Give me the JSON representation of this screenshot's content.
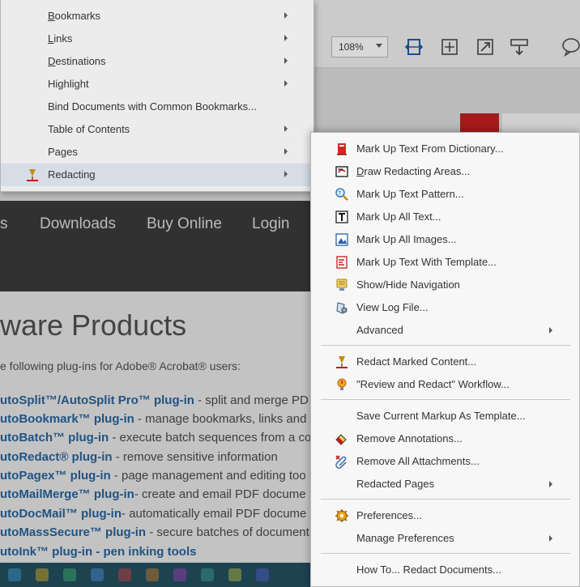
{
  "toolbar": {
    "zoom": "108%"
  },
  "website": {
    "nav": [
      "s",
      "Downloads",
      "Buy Online",
      "Login"
    ],
    "title": "ware Products",
    "intro": "e following plug-ins for Adobe® Acrobat® users:",
    "products": [
      {
        "link": "utoSplit™/AutoSplit Pro™ plug-in",
        "desc": " - split and merge PD"
      },
      {
        "link": "utoBookmark™ plug-in",
        "desc": " - manage bookmarks, links and"
      },
      {
        "link": "utoBatch™ plug-in",
        "desc": " - execute batch sequences from a co"
      },
      {
        "link": "utoRedact® plug-in",
        "desc": " - remove sensitive information"
      },
      {
        "link": "utoPagex™ plug-in",
        "desc": " - page management and editing too"
      },
      {
        "link": "utoMailMerge™ plug-in",
        "desc": "- create and email PDF docume"
      },
      {
        "link": "utoDocMail™ plug-in",
        "desc": "- automatically email PDF docume"
      },
      {
        "link": "utoMassSecure™ plug-in",
        "desc": " - secure batches of document"
      },
      {
        "link": "utoInk™ plug-in - pen inking tools",
        "desc": ""
      }
    ]
  },
  "left_menu": {
    "items": [
      {
        "label": "Bookmarks",
        "mnemonic": "B",
        "rest": "ookmarks",
        "submenu": true
      },
      {
        "label": "Links",
        "mnemonic": "L",
        "rest": "inks",
        "submenu": true
      },
      {
        "label": "Destinations",
        "mnemonic": "D",
        "rest": "estinations",
        "submenu": true
      },
      {
        "label": "Highlight",
        "mnemonic": "",
        "rest": "Highlight",
        "submenu": true
      },
      {
        "label": "Bind Documents with Common Bookmarks...",
        "mnemonic": "",
        "rest": "Bind Documents with Common Bookmarks...",
        "submenu": false
      },
      {
        "label": "Table of Contents",
        "mnemonic": "",
        "rest": "Table of Contents",
        "submenu": true
      },
      {
        "label": "Pages",
        "mnemonic": "",
        "rest": "Pages",
        "submenu": true
      },
      {
        "label": "Redacting",
        "mnemonic": "",
        "rest": "Redacting",
        "submenu": true
      }
    ]
  },
  "submenu": {
    "items": [
      {
        "label": "Mark Up Text From Dictionary...",
        "icon": "dictionary-icon"
      },
      {
        "label": "Draw Redacting Areas...",
        "mnemonic": "D",
        "rest": "raw Redacting Areas...",
        "icon": "draw-area-icon"
      },
      {
        "label": "Mark Up Text Pattern...",
        "icon": "text-pattern-icon"
      },
      {
        "label": "Mark Up All Text...",
        "icon": "text-t-icon"
      },
      {
        "label": "Mark Up All Images...",
        "icon": "image-icon"
      },
      {
        "label": "Mark Up Text With Template...",
        "icon": "template-icon"
      },
      {
        "label": "Show/Hide Navigation",
        "icon": "navigation-icon"
      },
      {
        "label": "View Log File...",
        "icon": "log-file-icon"
      },
      {
        "label": "Advanced",
        "submenu": true
      },
      {
        "label": "Redact Marked Content...",
        "icon": "redact-pen-icon"
      },
      {
        "label": "\"Review and Redact\" Workflow...",
        "icon": "lightbulb-icon"
      },
      {
        "label": "Save Current Markup As Template..."
      },
      {
        "label": "Remove Annotations...",
        "icon": "eraser-icon"
      },
      {
        "label": "Remove All Attachments...",
        "icon": "paperclip-x-icon"
      },
      {
        "label": "Redacted Pages",
        "submenu": true
      },
      {
        "label": "Preferences...",
        "icon": "gear-icon"
      },
      {
        "label": "Manage Preferences",
        "submenu": true
      },
      {
        "label": "How To... Redact Documents..."
      }
    ]
  }
}
